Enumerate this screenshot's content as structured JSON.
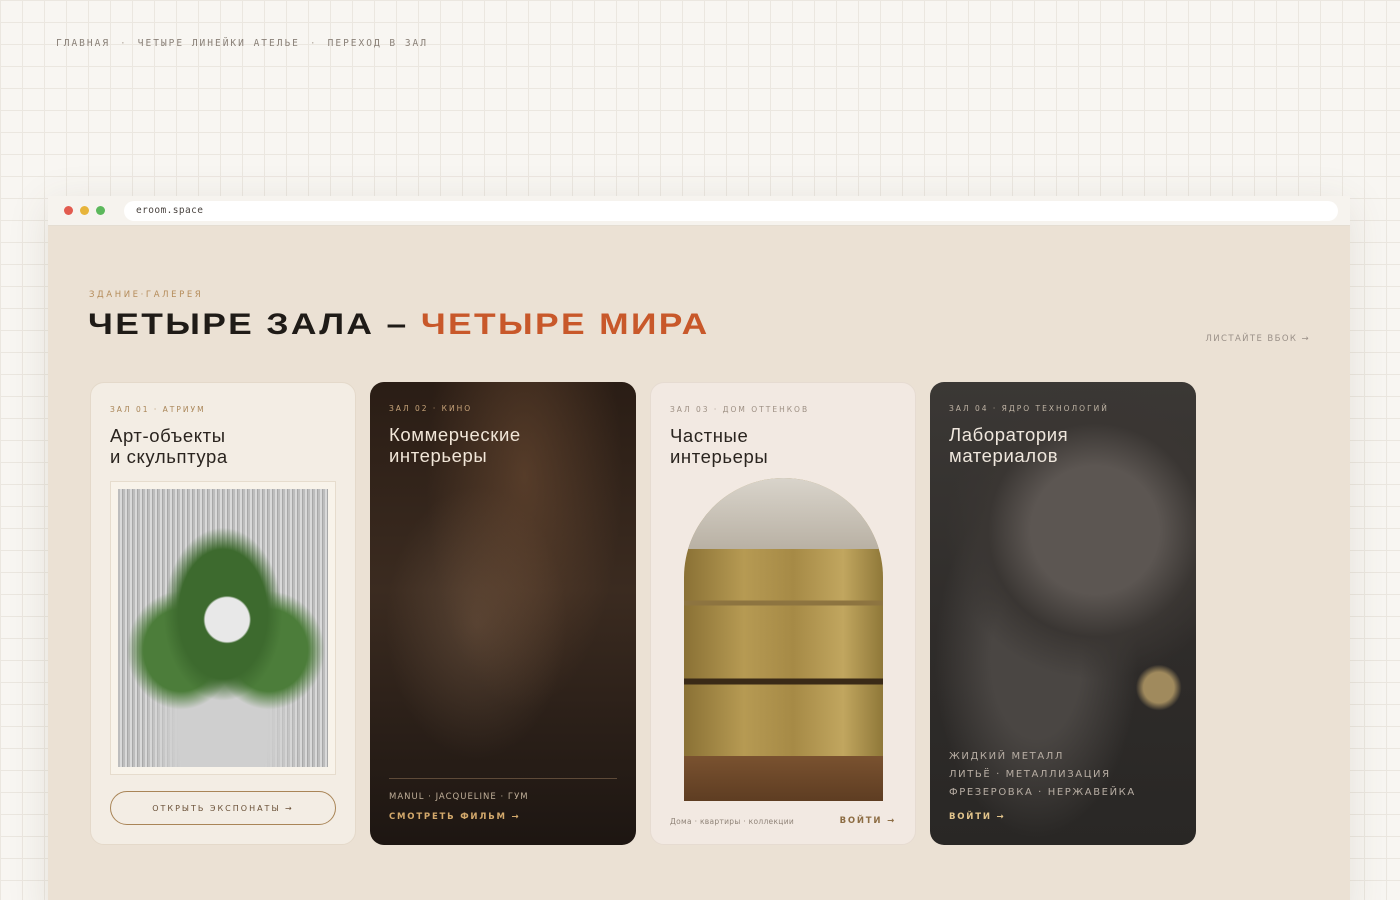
{
  "breadcrumb": {
    "items": [
      "ГЛАВНАЯ",
      "ЧЕТЫРЕ ЛИНЕЙКИ АТЕЛЬЕ",
      "ПЕРЕХОД В ЗАЛ"
    ],
    "separator": "·"
  },
  "browser": {
    "url": "eroom.space"
  },
  "page": {
    "eyebrow": "ЗДАНИЕ·ГАЛЕРЕЯ",
    "title_main": "ЧЕТЫРЕ ЗАЛА – ",
    "title_accent": "ЧЕТЫРЕ МИРА",
    "scroll_hint": "ЛИСТАЙТЕ ВБОК →"
  },
  "cards": [
    {
      "tag": "ЗАЛ 01 · АТРИУМ",
      "title": [
        "Арт-объекты",
        "и скульптура"
      ],
      "cta": "ОТКРЫТЬ ЭКСПОНАТЫ →"
    },
    {
      "tag": "ЗАЛ 02 · КИНО",
      "title": [
        "Коммерческие",
        "интерьеры"
      ],
      "brands": "MANUL · JACQUELINE · ГУМ",
      "link": "СМОТРЕТЬ ФИЛЬМ →"
    },
    {
      "tag": "ЗАЛ 03 · ДОМ ОТТЕНКОВ",
      "title": [
        "Частные",
        "интерьеры"
      ],
      "meta": "Дома · квартиры · коллекции",
      "link": "ВОЙТИ →"
    },
    {
      "tag": "ЗАЛ 04 · ЯДРО ТЕХНОЛОГИЙ",
      "title": [
        "Лаборатория",
        "материалов"
      ],
      "features": [
        "ЖИДКИЙ МЕТАЛЛ",
        "ЛИТЬЁ · МЕТАЛЛИЗАЦИЯ",
        "ФРЕЗЕРОВКА · НЕРЖАВЕЙКА"
      ],
      "link": "ВОЙТИ →"
    }
  ],
  "colors": {
    "accent": "#c8582a",
    "gold": "#b58c5a",
    "panel_bg": "#ebe1d4"
  }
}
